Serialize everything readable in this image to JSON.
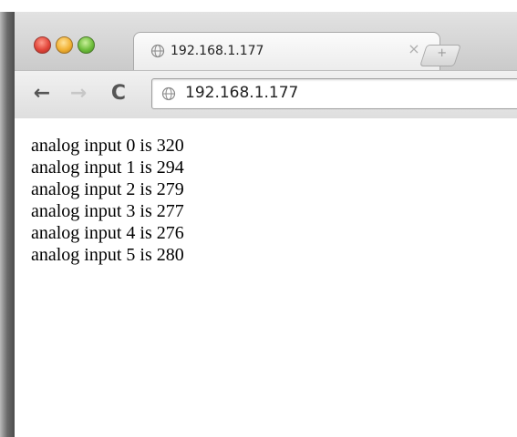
{
  "browser": {
    "tab": {
      "title": "192.168.1.177",
      "close_glyph": "×"
    },
    "new_tab_glyph": "+",
    "toolbar": {
      "back_glyph": "←",
      "forward_glyph": "→",
      "reload_glyph": "C",
      "url": "192.168.1.177"
    },
    "icons": {
      "window_controls": [
        "close",
        "minimize",
        "zoom"
      ],
      "tab_favicon": "globe-icon",
      "address_icon": "globe-icon"
    },
    "colors": {
      "close": "#e2463a",
      "minimize": "#f2b133",
      "zoom": "#6fbe3c"
    }
  },
  "page": {
    "lines": [
      "analog input 0 is 320",
      "analog input 1 is 294",
      "analog input 2 is 279",
      "analog input 3 is 277",
      "analog input 4 is 276",
      "analog input 5 is 280"
    ]
  }
}
